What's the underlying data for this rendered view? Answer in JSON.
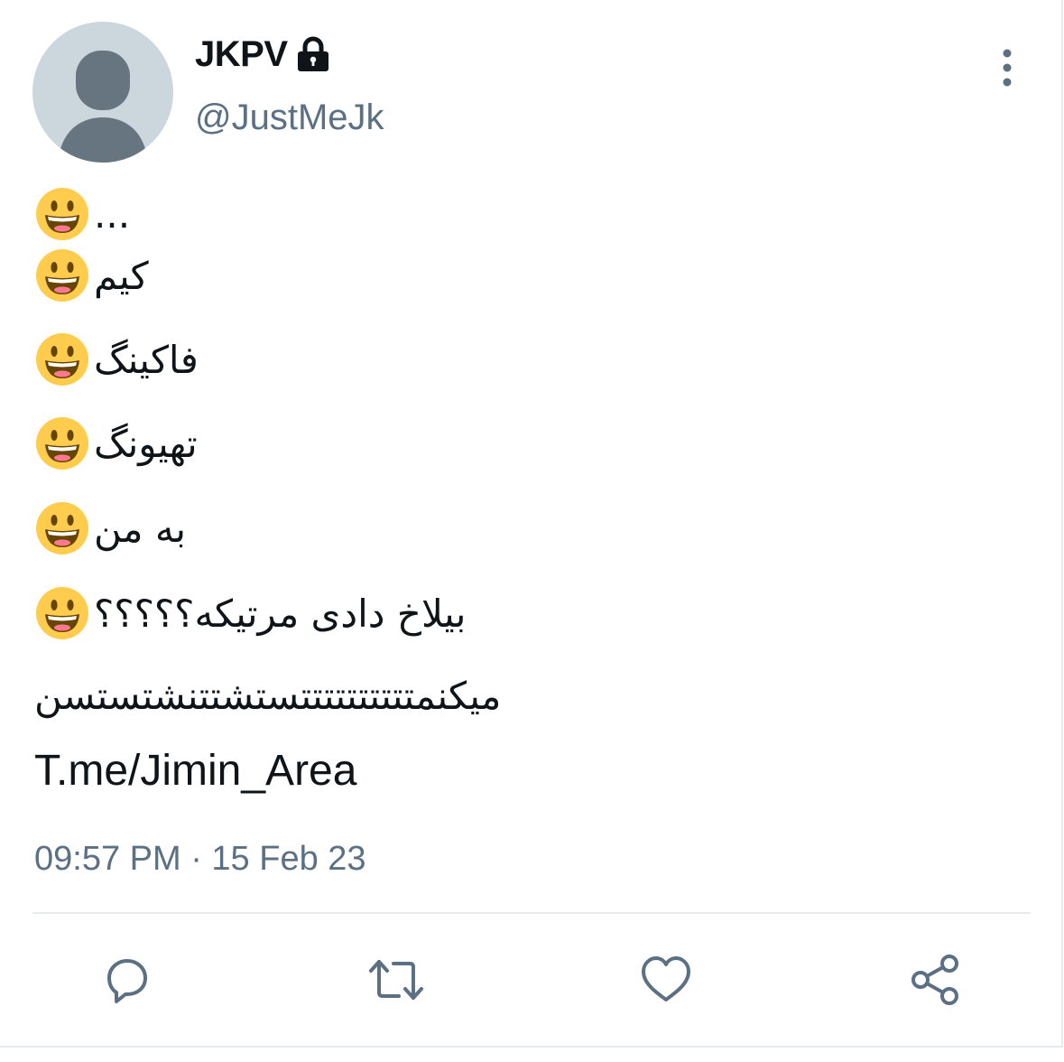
{
  "tweet": {
    "display_name": "JKPV",
    "handle": "@JustMeJk",
    "lines": {
      "l1": "...",
      "l2": "کیم",
      "l3": "فاکینگ",
      "l4": "تهیونگ",
      "l5": "به من",
      "l6": "بیلاخ دادی مرتیکه؟؟؟؟؟",
      "l7": "میکنمتتتتتتتتتتستشتتنشتستسن"
    },
    "link": "T.me/Jimin_Area",
    "timestamp": "09:57 PM · 15 Feb 23"
  },
  "icons": {
    "lock": "lock-icon",
    "more": "more-vertical-icon",
    "emoji": "grinning-face-emoji",
    "reply": "reply-icon",
    "retweet": "retweet-icon",
    "like": "heart-icon",
    "share": "share-icon"
  },
  "colors": {
    "text": "#0f1419",
    "secondary": "#5b7083",
    "avatar_bg": "#ccd6dd",
    "avatar_fg": "#66757f",
    "emoji_face": "#ffcc4d"
  }
}
